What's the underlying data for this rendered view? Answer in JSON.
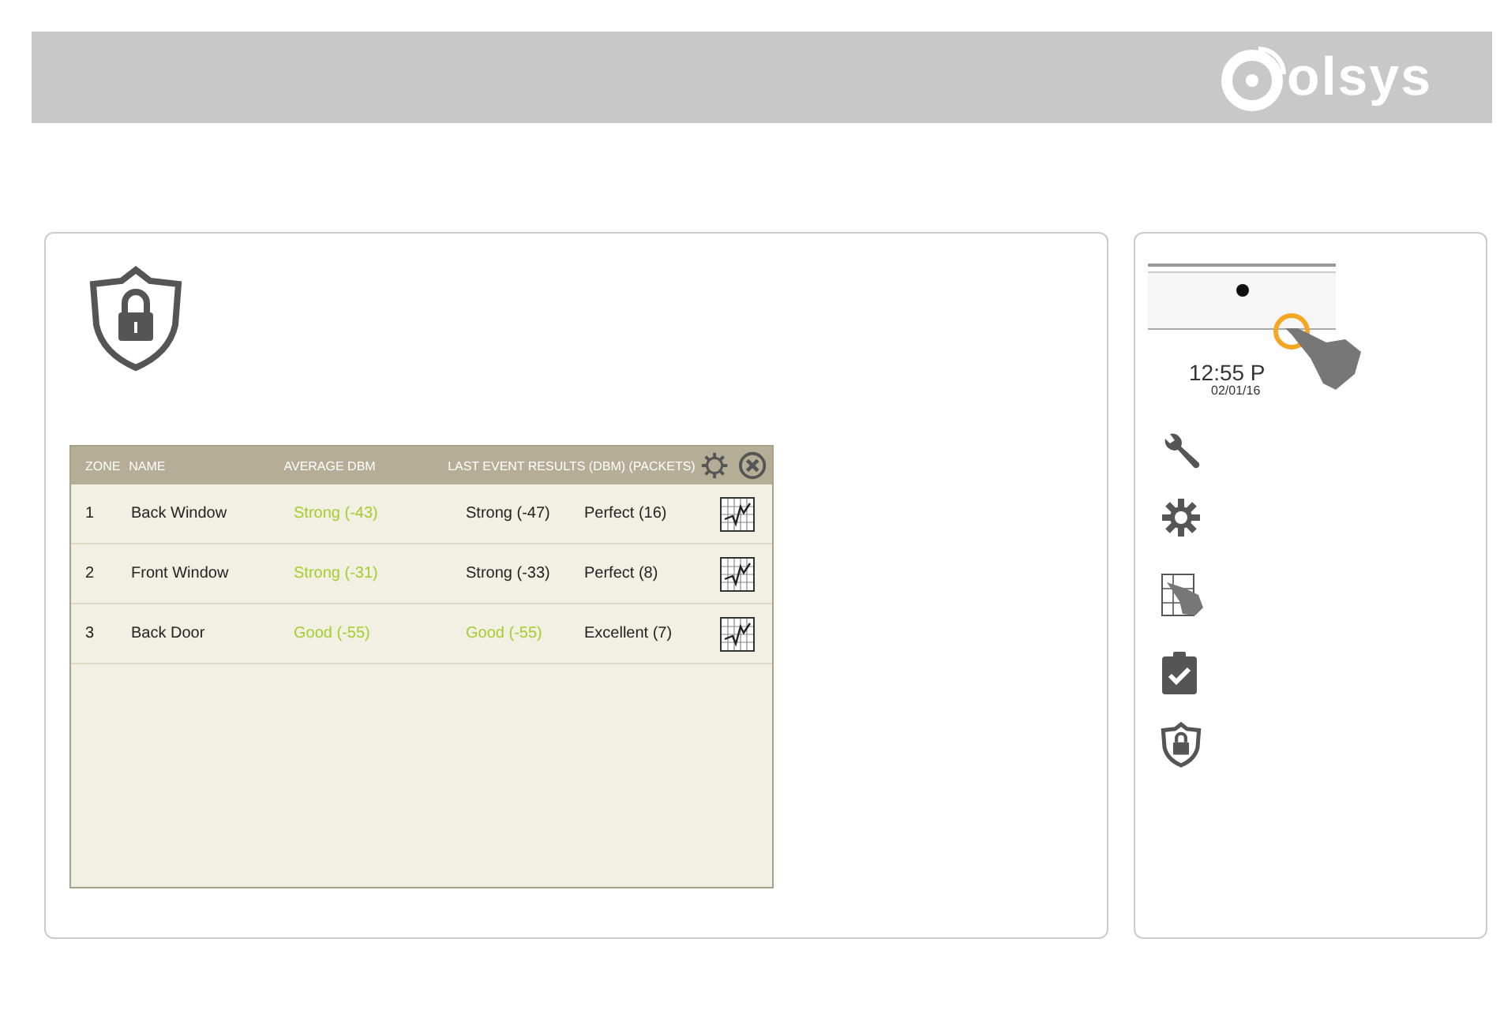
{
  "header": {
    "logo_text": "olsys"
  },
  "table": {
    "columns": [
      "ZONE",
      "NAME",
      "AVERAGE DBM",
      "LAST EVENT RESULTS (DBM) (PACKETS)"
    ],
    "rows": [
      {
        "zone": "1",
        "name": "Back Window",
        "average": {
          "text": "Strong (-43)",
          "color": "#a6cc2e"
        },
        "last": {
          "text": "Strong (-47)",
          "color": "#222222"
        },
        "packets": "Perfect (16)"
      },
      {
        "zone": "2",
        "name": "Front Window",
        "average": {
          "text": "Strong (-31)",
          "color": "#a6cc2e"
        },
        "last": {
          "text": "Strong (-33)",
          "color": "#222222"
        },
        "packets": "Perfect (8)"
      },
      {
        "zone": "3",
        "name": "Back Door",
        "average": {
          "text": "Good (-55)",
          "color": "#a6cc2e"
        },
        "last": {
          "text": "Good (-55)",
          "color": "#a6cc2e"
        },
        "packets": "Excellent (7)"
      }
    ]
  },
  "sidebar": {
    "time": "12:55 P",
    "date": "02/01/16"
  }
}
